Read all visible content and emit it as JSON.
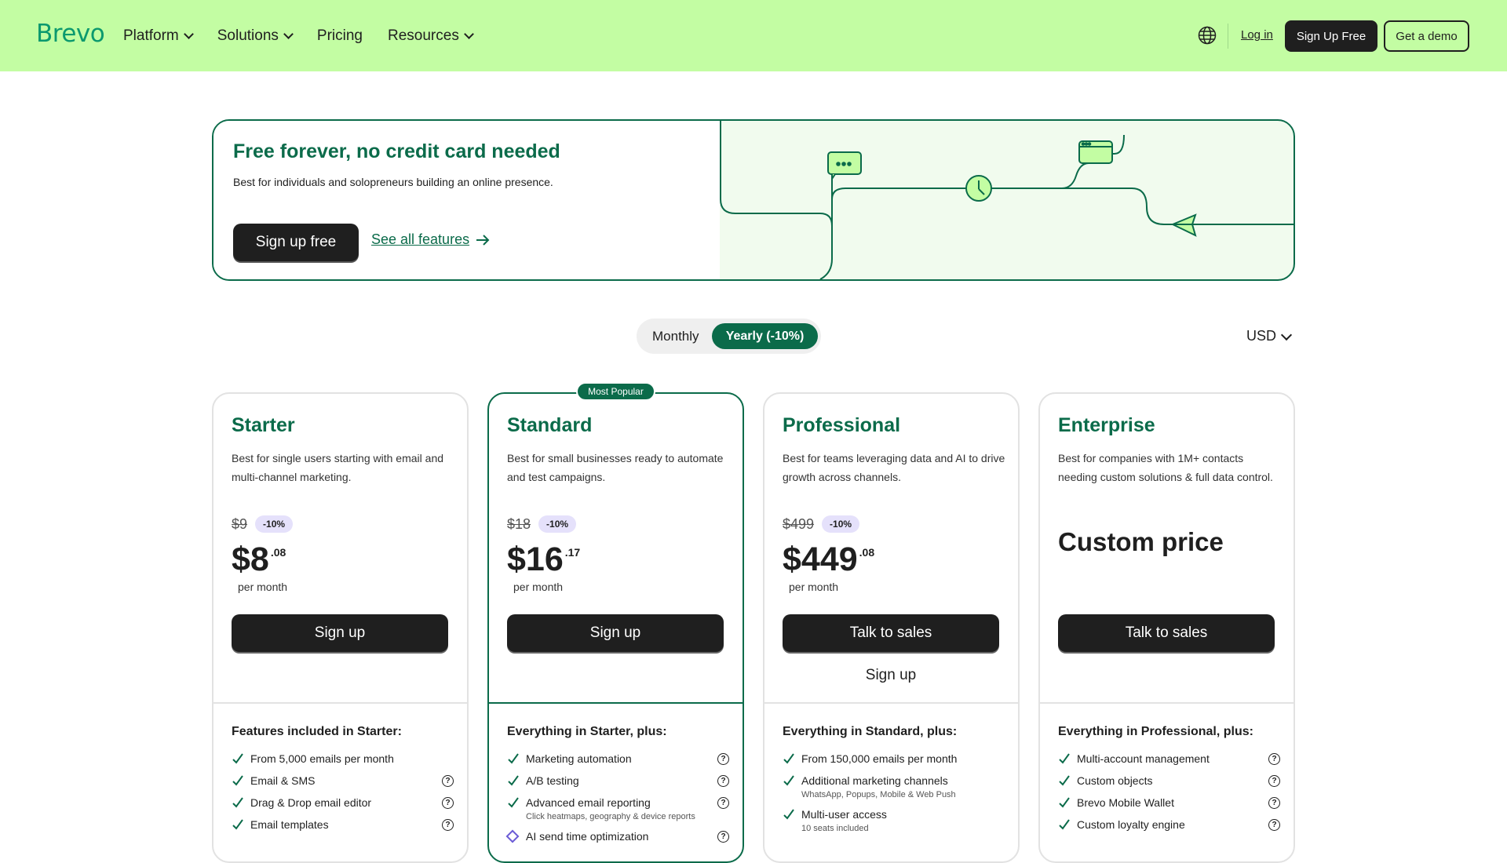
{
  "header": {
    "logo": "Brevo",
    "nav": [
      "Platform",
      "Solutions",
      "Pricing",
      "Resources"
    ],
    "login": "Log in",
    "signup_free": "Sign Up Free",
    "demo": "Get a demo"
  },
  "banner": {
    "title": "Free forever, no credit card needed",
    "subtitle": "Best for individuals and solopreneurs building an online presence.",
    "cta": "Sign up free",
    "link": "See all features"
  },
  "billing": {
    "monthly": "Monthly",
    "yearly": "Yearly (-10%)",
    "currency": "USD"
  },
  "popular_badge": "Most Popular",
  "plans": [
    {
      "name": "Starter",
      "desc": "Best for single users starting with email and multi-channel marketing.",
      "old_price": "$9",
      "discount": "-10%",
      "price_main": "$8",
      "price_cents": ".08",
      "per": "per month",
      "cta": "Sign up",
      "features_title": "Features included in Starter:",
      "features": [
        {
          "text": "From 5,000 emails per month",
          "sub": ""
        },
        {
          "text": "Email & SMS",
          "sub": ""
        },
        {
          "text": "Drag & Drop email editor",
          "sub": ""
        },
        {
          "text": "Email templates",
          "sub": ""
        }
      ]
    },
    {
      "name": "Standard",
      "desc": "Best for small businesses ready to automate and test campaigns.",
      "old_price": "$18",
      "discount": "-10%",
      "price_main": "$16",
      "price_cents": ".17",
      "per": "per month",
      "cta": "Sign up",
      "features_title": "Everything in Starter, plus:",
      "features": [
        {
          "text": "Marketing automation",
          "sub": ""
        },
        {
          "text": "A/B testing",
          "sub": ""
        },
        {
          "text": "Advanced email reporting",
          "sub": "Click heatmaps, geography & device reports"
        },
        {
          "text": "AI send time optimization",
          "sub": ""
        }
      ]
    },
    {
      "name": "Professional",
      "desc": "Best for teams leveraging data and AI to drive growth across channels.",
      "old_price": "$499",
      "discount": "-10%",
      "price_main": "$449",
      "price_cents": ".08",
      "per": "per month",
      "cta": "Talk to sales",
      "cta2": "Sign up",
      "features_title": "Everything in Standard, plus:",
      "features": [
        {
          "text": "From 150,000 emails per month",
          "sub": ""
        },
        {
          "text": "Additional marketing channels",
          "sub": "WhatsApp, Popups, Mobile & Web Push"
        },
        {
          "text": "Multi-user access",
          "sub": "10 seats included"
        }
      ]
    },
    {
      "name": "Enterprise",
      "desc": "Best for companies with 1M+ contacts needing custom solutions & full data control.",
      "custom_price": "Custom price",
      "cta": "Talk to sales",
      "features_title": "Everything in Professional, plus:",
      "features": [
        {
          "text": "Multi-account management",
          "sub": ""
        },
        {
          "text": "Custom objects",
          "sub": ""
        },
        {
          "text": "Brevo Mobile Wallet",
          "sub": ""
        },
        {
          "text": "Custom loyalty engine",
          "sub": ""
        }
      ]
    }
  ],
  "colors": {
    "brand_green": "#0b6b4a",
    "header_bg": "#c3fda3",
    "logo_green": "#0b996e",
    "discount_bg": "#e5e1fb"
  }
}
